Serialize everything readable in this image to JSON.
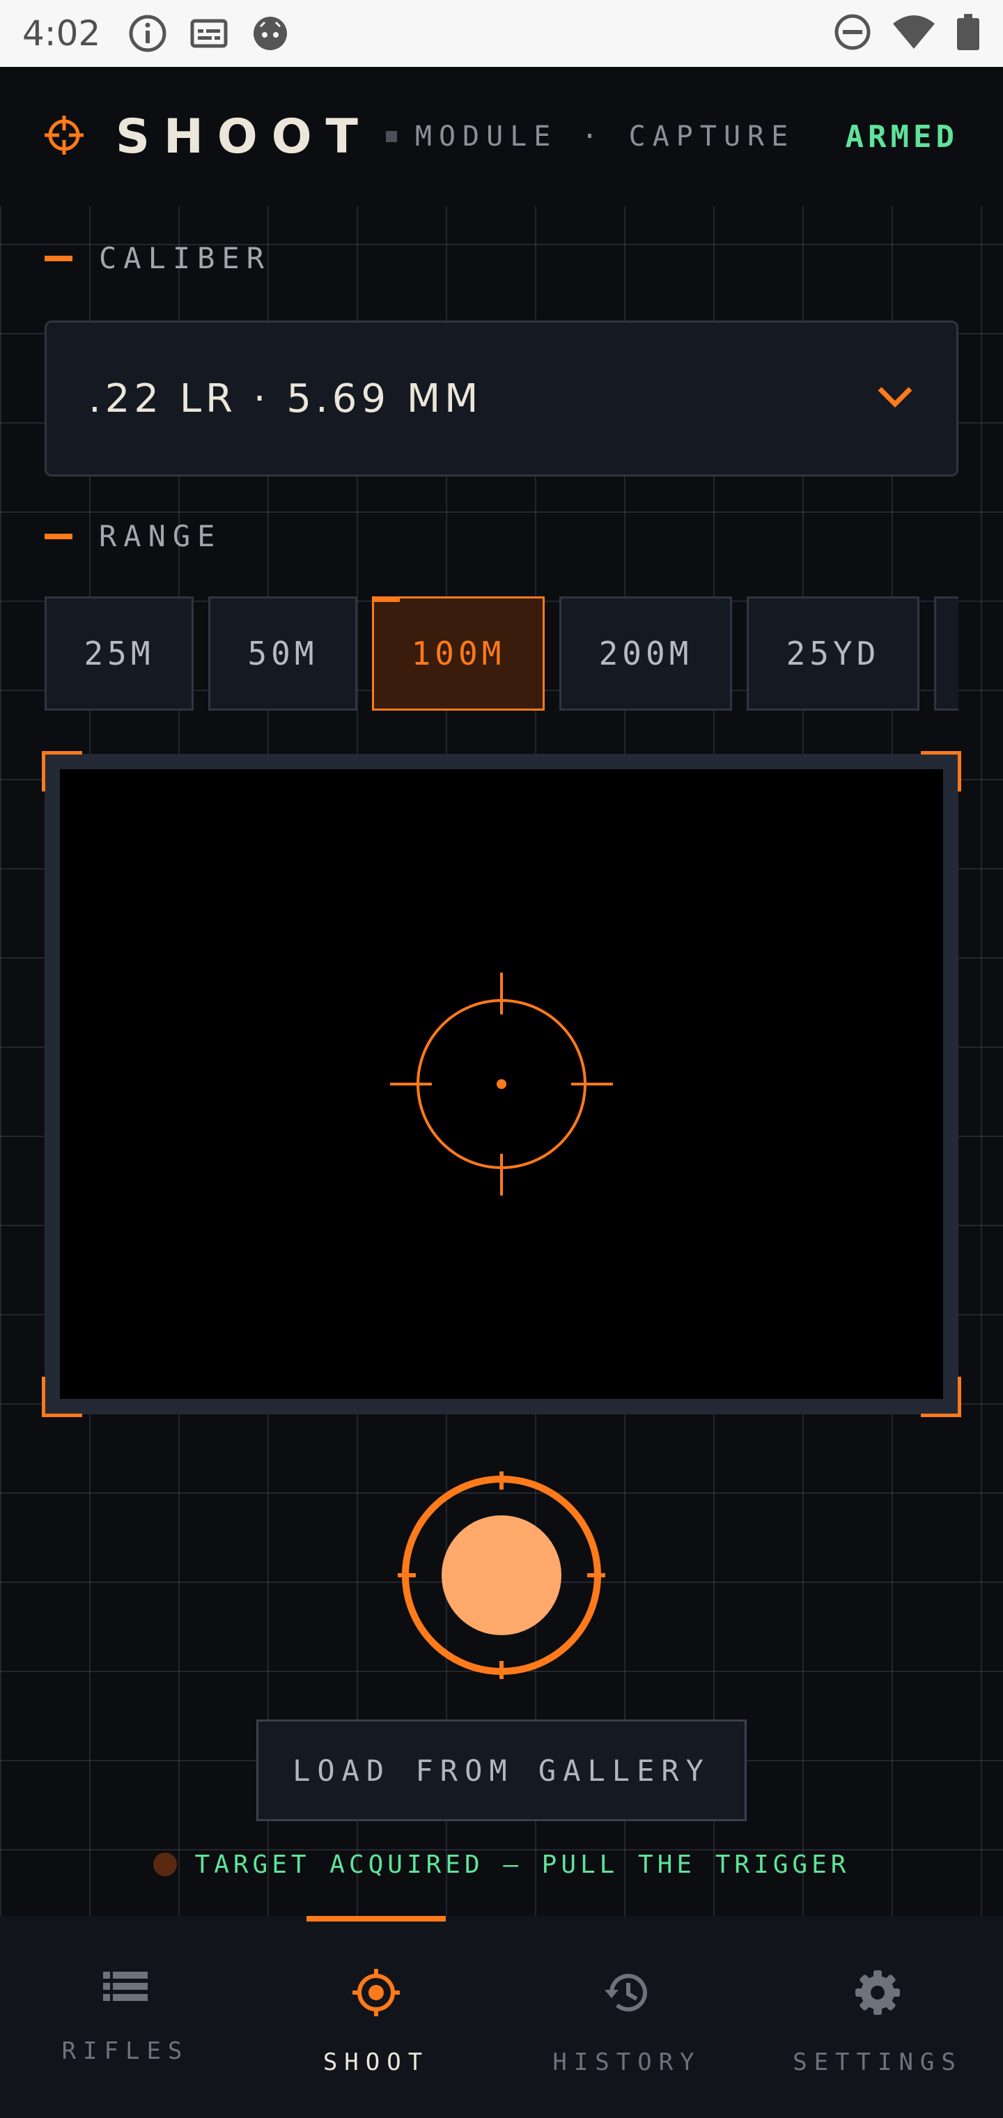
{
  "status_bar": {
    "time": "4:02",
    "left_icons": [
      "info-icon",
      "subtitles-icon",
      "android-icon"
    ],
    "right_icons": [
      "do-not-disturb-icon",
      "wifi-icon",
      "battery-icon"
    ]
  },
  "header": {
    "title": "SHOOT",
    "subtitle": "MODULE · CAPTURE",
    "status": "ARMED"
  },
  "caliber": {
    "label": "CALIBER",
    "selected": ".22 LR · 5.69 MM"
  },
  "range": {
    "label": "RANGE",
    "options": [
      "25M",
      "50M",
      "100M",
      "200M",
      "25YD"
    ],
    "selected": "100M"
  },
  "capture": {
    "gallery_label": "LOAD FROM GALLERY",
    "status_text": "TARGET ACQUIRED — PULL THE TRIGGER"
  },
  "nav": {
    "items": [
      {
        "label": "RIFLES",
        "icon": "list-icon"
      },
      {
        "label": "SHOOT",
        "icon": "target-icon"
      },
      {
        "label": "HISTORY",
        "icon": "history-icon"
      },
      {
        "label": "SETTINGS",
        "icon": "gear-icon"
      }
    ],
    "active": "SHOOT"
  },
  "colors": {
    "accent": "#ff7a1a",
    "armed": "#5fe39a",
    "background": "#0b0d11",
    "surface": "#151922",
    "shutter_fill": "#ffa96a"
  }
}
